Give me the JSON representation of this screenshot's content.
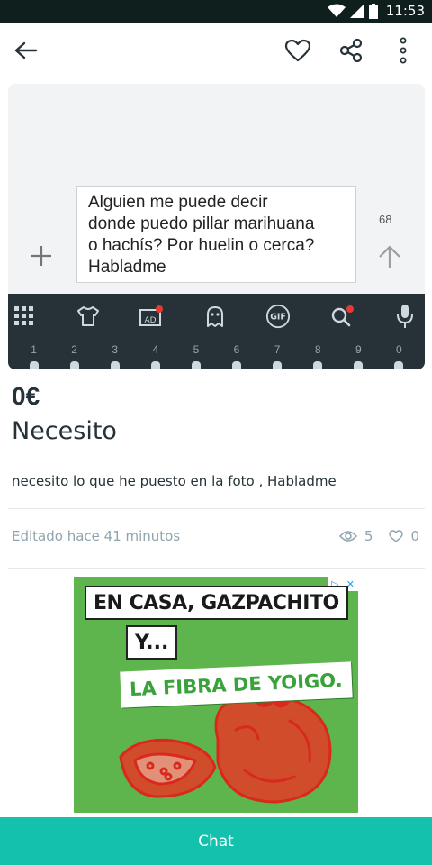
{
  "status_bar": {
    "time": "11:53",
    "icons": [
      "wifi-icon",
      "cell-signal-icon",
      "battery-icon"
    ]
  },
  "app_bar": {
    "icons": [
      "back-arrow-icon",
      "heart-icon",
      "share-icon",
      "more-vert-icon"
    ]
  },
  "photo": {
    "message_text": "Alguien  me puede decir\ndonde puedo pillar marihuana\no hachís? Por huelin o cerca?\nHabladme",
    "char_counter": "68",
    "keyboard_numbers": [
      "1",
      "2",
      "3",
      "4",
      "5",
      "6",
      "7",
      "8",
      "9",
      "0"
    ],
    "keyboard_tools": [
      "apps-grid-icon",
      "shirt-icon",
      "ad-sticker-icon",
      "ghost-icon",
      "gif-icon",
      "search-icon",
      "mic-icon"
    ]
  },
  "listing": {
    "price": "0€",
    "title": "Necesito",
    "description": "necesito lo que he puesto en la foto , Habladme",
    "edited": "Editado hace 41 minutos",
    "views": "5",
    "favorites": "0"
  },
  "ad": {
    "line1": "EN CASA, GAZPACHITO",
    "line2": "Y...",
    "line3": "LA FIBRA DE YOIGO."
  },
  "chat_button": {
    "label": "Chat"
  },
  "colors": {
    "status_bar": "#0f1f1e",
    "accent": "#13c1ac",
    "keyboard": "#263238",
    "ad_green": "#5fb54d",
    "tomato_red": "#d9291c"
  }
}
